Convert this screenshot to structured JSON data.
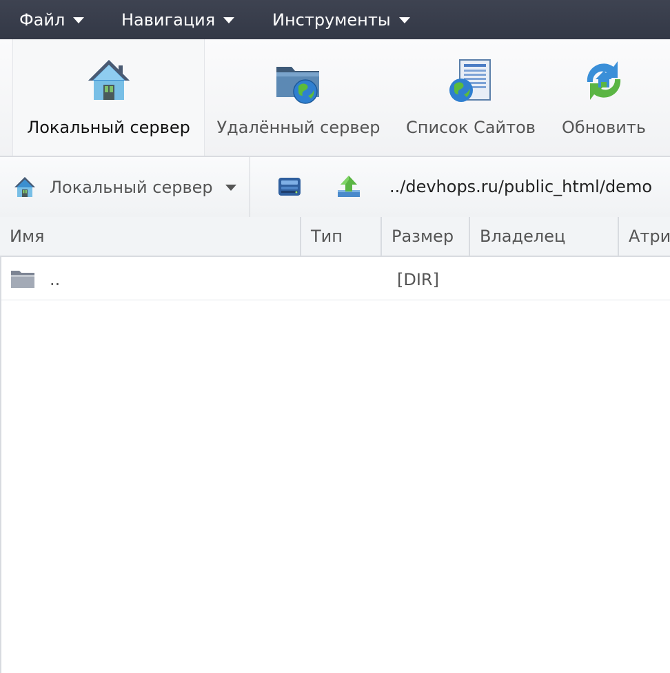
{
  "menubar": {
    "items": [
      {
        "label": "Файл"
      },
      {
        "label": "Навигация"
      },
      {
        "label": "Инструменты"
      }
    ]
  },
  "toolbar": {
    "buttons": [
      {
        "label": "Локальный сервер",
        "icon": "home-icon",
        "active": true
      },
      {
        "label": "Удалённый сервер",
        "icon": "remote-folder-globe-icon",
        "active": false
      },
      {
        "label": "Список Сайтов",
        "icon": "site-list-globe-icon",
        "active": false
      },
      {
        "label": "Обновить",
        "icon": "refresh-icon",
        "active": false
      }
    ]
  },
  "pathbar": {
    "server_label": "Локальный сервер",
    "server_icon": "home-icon",
    "drive_icon": "drive-icon",
    "up_icon": "folder-up-icon",
    "path": "../devhops.ru/public_html/demo"
  },
  "table": {
    "columns": [
      "Имя",
      "Тип",
      "Размер",
      "Владелец",
      "Атри"
    ],
    "rows": [
      {
        "name": "..",
        "type": "",
        "size": "[DIR]",
        "owner": "",
        "attrs": "",
        "icon": "folder-icon"
      }
    ]
  },
  "colors": {
    "menubar_bg": "#383d4b",
    "accent_blue": "#3a7bd5",
    "refresh_green": "#5bb544"
  }
}
